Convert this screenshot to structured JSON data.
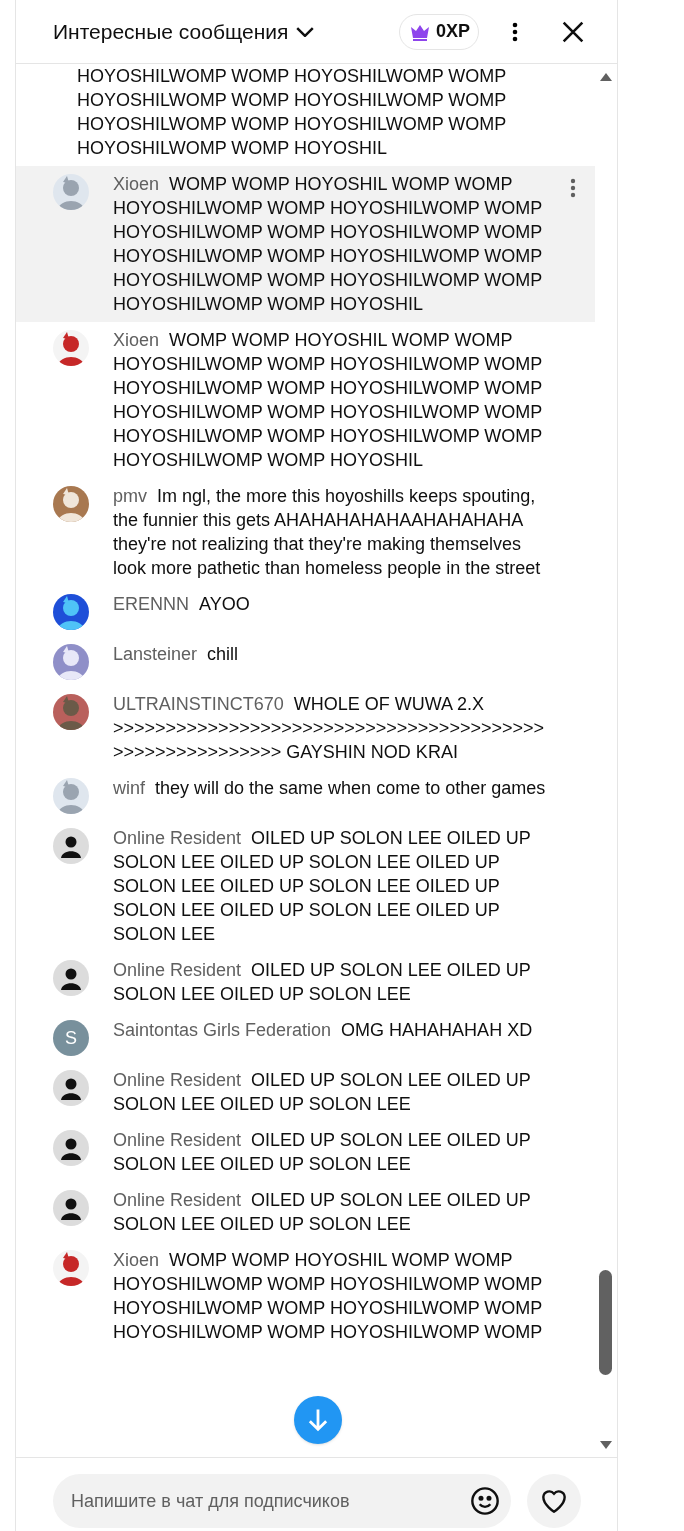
{
  "header": {
    "title": "Интересные сообщения",
    "xp": "0XP"
  },
  "messages": [
    {
      "text": "HOYOSHILWOMP WOMP HOYOSHILWOMP WOMP HOYOSHILWOMP WOMP HOYOSHILWOMP WOMP HOYOSHILWOMP WOMP HOYOSHILWOMP WOMP HOYOSHILWOMP WOMP HOYOSHIL",
      "avatar": {
        "kind": "none"
      },
      "highlighted": false
    },
    {
      "author": "Xioen",
      "text": "WOMP WOMP HOYOSHIL WOMP WOMP HOYOSHILWOMP WOMP HOYOSHILWOMP WOMP HOYOSHILWOMP WOMP HOYOSHILWOMP WOMP HOYOSHILWOMP WOMP HOYOSHILWOMP WOMP HOYOSHILWOMP WOMP HOYOSHILWOMP WOMP HOYOSHILWOMP WOMP HOYOSHIL",
      "highlighted": true
    },
    {
      "author": "Xioen",
      "text": "WOMP WOMP HOYOSHIL WOMP WOMP HOYOSHILWOMP WOMP HOYOSHILWOMP WOMP HOYOSHILWOMP WOMP HOYOSHILWOMP WOMP HOYOSHILWOMP WOMP HOYOSHILWOMP WOMP HOYOSHILWOMP WOMP HOYOSHILWOMP WOMP HOYOSHILWOMP WOMP HOYOSHIL",
      "highlighted": false
    },
    {
      "author": "pmv",
      "text": "Im ngl, the more this hoyoshills keeps spouting, the funnier this gets AHAHAHAHAHAAHAHAHAHA they're not realizing that they're making themselves look more pathetic than homeless people in the street",
      "highlighted": false
    },
    {
      "author": "ERENNN",
      "text": "AYOO",
      "highlighted": false
    },
    {
      "author": "Lansteiner",
      "text": "chill",
      "highlighted": false
    },
    {
      "author": "ULTRAINSTINCT670",
      "text": "WHOLE OF WUWA 2.X >>>>>>>>>>>>>>>>>>>>>>>>>>>>>>>>>>>>>>>>>>>>>>>>>>>>>>>>> GAYSHIN NOD KRAI",
      "highlighted": false
    },
    {
      "author": "winf",
      "text": "they will do the same when come to other games",
      "highlighted": false
    },
    {
      "author": "Online Resident",
      "text": "OILED UP SOLON LEE OILED UP SOLON LEE OILED UP SOLON LEE OILED UP SOLON LEE OILED UP SOLON LEE OILED UP SOLON LEE OILED UP SOLON LEE OILED UP SOLON LEE",
      "avatar": {
        "kind": "silhouette"
      },
      "highlighted": false
    },
    {
      "author": "Online Resident",
      "text": "OILED UP SOLON LEE OILED UP SOLON LEE OILED UP SOLON LEE",
      "avatar": {
        "kind": "silhouette"
      },
      "highlighted": false
    },
    {
      "author": "Saintontas Girls Federation",
      "text": "OMG HAHAHAHAH XD",
      "avatar": {
        "kind": "letter",
        "letter": "S",
        "color": "#78909c"
      },
      "highlighted": false
    },
    {
      "author": "Online Resident",
      "text": "OILED UP SOLON LEE OILED UP SOLON LEE OILED UP SOLON LEE",
      "avatar": {
        "kind": "silhouette"
      },
      "highlighted": false
    },
    {
      "author": "Online Resident",
      "text": "OILED UP SOLON LEE OILED UP SOLON LEE OILED UP SOLON LEE",
      "avatar": {
        "kind": "silhouette"
      },
      "highlighted": false
    },
    {
      "author": "Online Resident",
      "text": "OILED UP SOLON LEE OILED UP SOLON LEE OILED UP SOLON LEE",
      "avatar": {
        "kind": "silhouette"
      },
      "highlighted": false
    },
    {
      "author": "Xioen",
      "text": "WOMP WOMP HOYOSHIL WOMP WOMP HOYOSHILWOMP WOMP HOYOSHILWOMP WOMP HOYOSHILWOMP WOMP HOYOSHILWOMP WOMP HOYOSHILWOMP WOMP HOYOSHILWOMP WOMP",
      "highlighted": false
    }
  ],
  "input": {
    "placeholder": "Напишите в чат для подписчиков"
  }
}
